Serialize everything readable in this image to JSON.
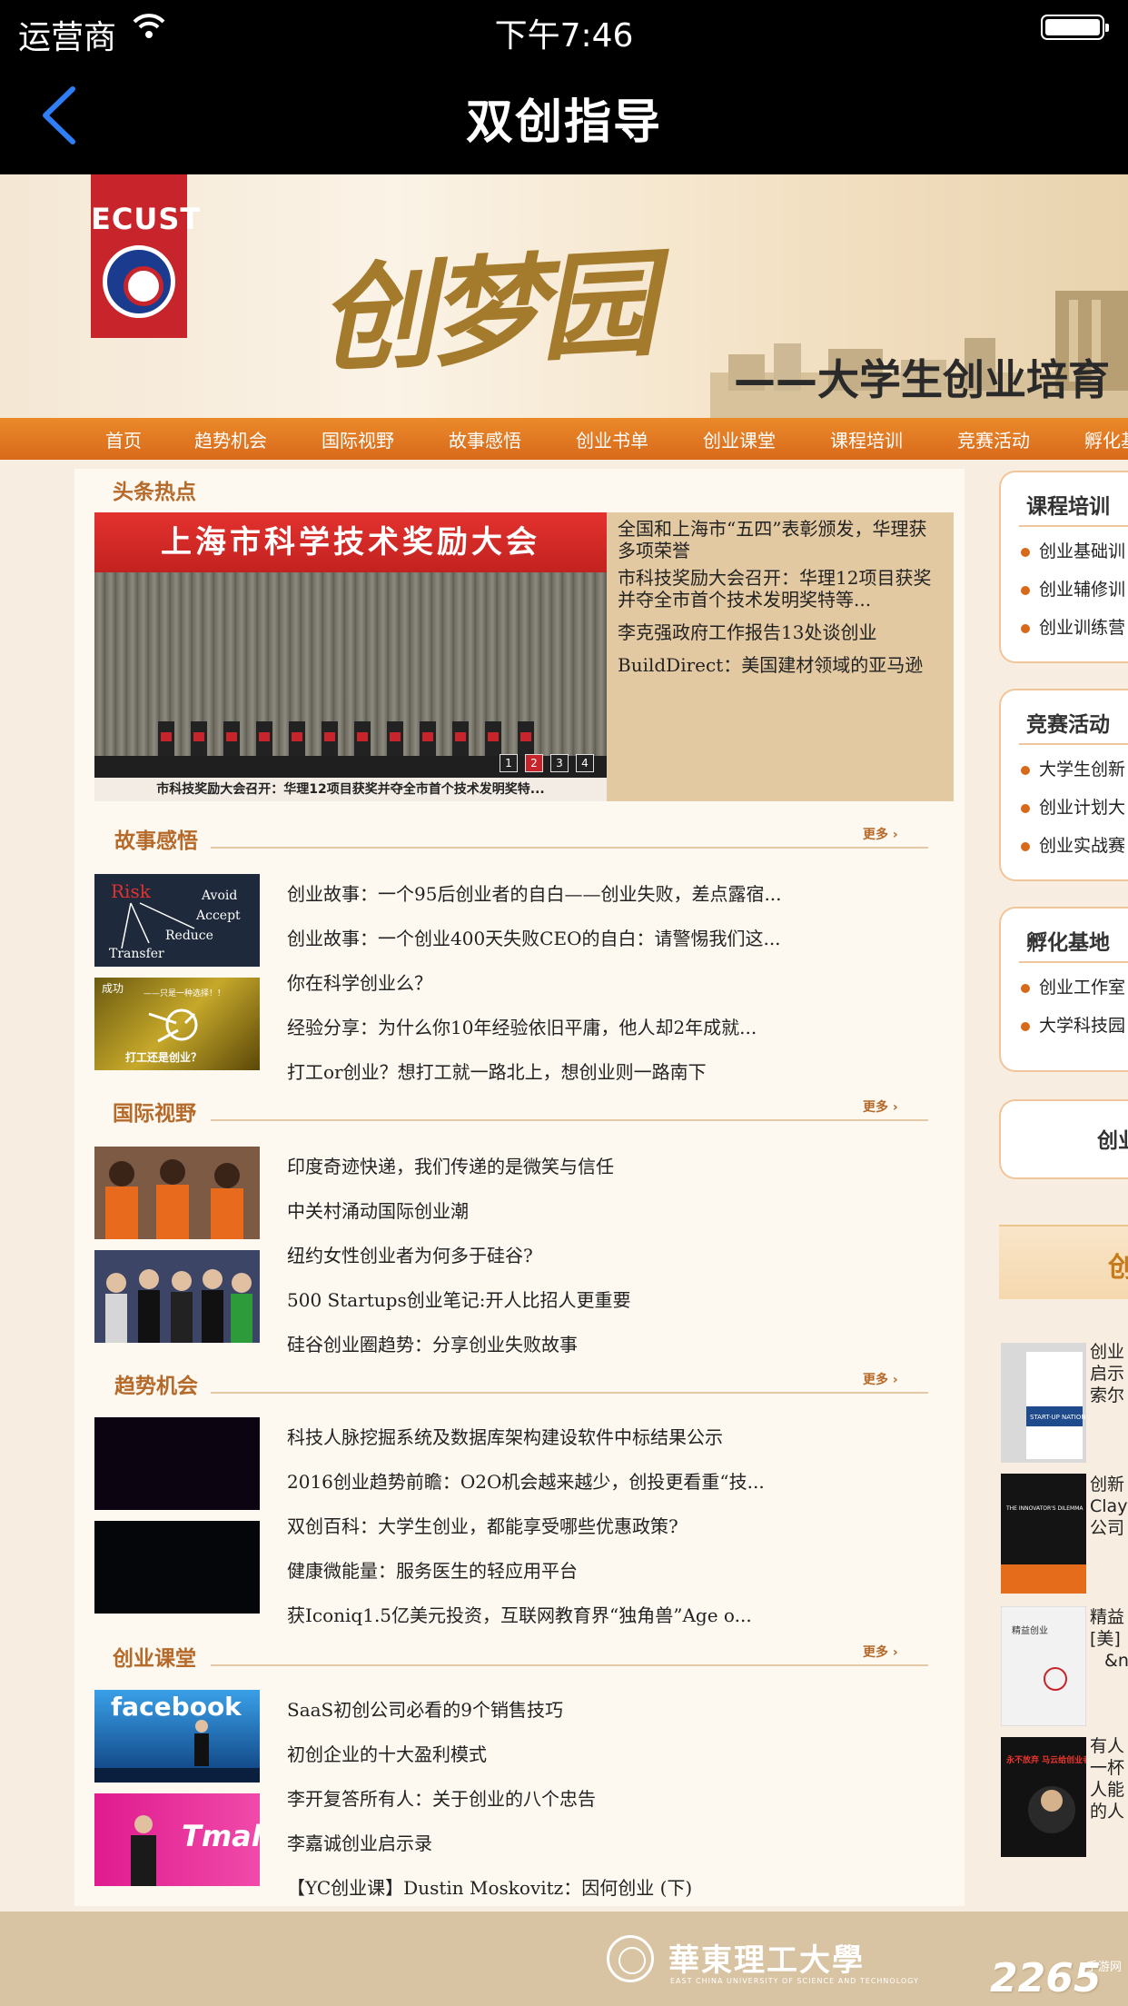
{
  "status": {
    "carrier": "运营商",
    "time": "下午7:46"
  },
  "nav": {
    "title": "双创指导",
    "back_icon": "chevron-left-icon",
    "accent": "#2f7ef5"
  },
  "banner": {
    "school_abbr": "ECUST",
    "brand": "创梦园",
    "subtitle": "——大学生创业培育"
  },
  "menu": [
    "首页",
    "趋势机会",
    "国际视野",
    "故事感悟",
    "创业书单",
    "创业课堂",
    "课程培训",
    "竞赛活动",
    "孵化基"
  ],
  "hot": {
    "title": "头条热点",
    "image_banner": "上海市科学技术奖励大会",
    "caption": "市科技奖励大会召开：华理12项目获奖并夺全市首个技术发明奖特...",
    "pages": [
      "1",
      "2",
      "3",
      "4"
    ],
    "active_page": "2",
    "items": [
      "全国和上海市“五四”表彰颁发，华理获多项荣誉",
      "市科技奖励大会召开：华理12项目获奖并夺全市首个技术发明奖特等...",
      "李克强政府工作报告13处谈创业",
      "BuildDirect：美国建材领域的亚马逊"
    ]
  },
  "sections": {
    "story": {
      "title": "故事感悟",
      "more": "更多",
      "thumb1_text": [
        "Risk",
        "Avoid",
        "Accept",
        "Reduce",
        "Transfer"
      ],
      "thumb2_text": [
        "成功",
        "——只是一种选择！！",
        "打工还是创业？"
      ],
      "links": [
        "创业故事：一个95后创业者的自白——创业失败，差点露宿...",
        "创业故事：一个创业400天失败CEO的自白：请警惕我们这...",
        "你在科学创业么？",
        "经验分享：为什么你10年经验依旧平庸，他人却2年成就...",
        "打工or创业？想打工就一路北上，想创业则一路南下"
      ]
    },
    "intl": {
      "title": "国际视野",
      "more": "更多",
      "links": [
        "印度奇迹快递，我们传递的是微笑与信任",
        "中关村涌动国际创业潮",
        "纽约女性创业者为何多于硅谷?",
        "500 Startups创业笔记:开人比招人更重要",
        "硅谷创业圈趋势：分享创业失败故事"
      ]
    },
    "trend": {
      "title": "趋势机会",
      "more": "更多",
      "links": [
        "科技人脉挖掘系统及数据库架构建设软件中标结果公示",
        "2016创业趋势前瞻：O2O机会越来越少，创投更看重“技...",
        "双创百科：大学生创业，都能享受哪些优惠政策?",
        "健康微能量：服务医生的轻应用平台",
        "获Iconiq1.5亿美元投资，互联网教育界“独角兽”Age o..."
      ]
    },
    "class": {
      "title": "创业课堂",
      "more": "更多",
      "thumb1_text": "facebook",
      "thumb2_text": "Tmall",
      "links": [
        "SaaS初创公司必看的9个销售技巧",
        "初创企业的十大盈利模式",
        "李开复答所有人：关于创业的八个忠告",
        "李嘉诚创业启示录",
        "【YC创业课】Dustin Moskovitz：因何创业 (下)"
      ]
    }
  },
  "sidebar": {
    "course": {
      "title": "课程培训",
      "items": [
        "创业基础训",
        "创业辅修训",
        "创业训练营"
      ]
    },
    "contest": {
      "title": "竞赛活动",
      "items": [
        "大学生创新",
        "创业计划大",
        "创业实战赛"
      ]
    },
    "incubate": {
      "title": "孵化基地",
      "items": [
        "创业工作室",
        "大学科技园"
      ]
    },
    "more_box": "创业",
    "booklist_title": "创",
    "books": [
      {
        "cover": "START-UP NATION",
        "text": [
          "创业",
          "启示",
          "索尔"
        ]
      },
      {
        "cover": "THE INNOVATOR'S DILEMMA",
        "text": [
          "创新",
          "Clayt",
          "公司"
        ]
      },
      {
        "cover": "精益创业",
        "text": [
          "精益",
          "[美]",
          "&n"
        ]
      },
      {
        "cover": "永不放弃 马云给创业者的24堂课",
        "text": [
          "有人",
          "一杯",
          "人能",
          "的人"
        ]
      }
    ]
  },
  "footer": {
    "school_cn": "華東理工大學",
    "school_en": "EAST CHINA UNIVERSITY OF SCIENCE AND TECHNOLOGY",
    "watermark": "2265",
    "watermark_sub": "手游网"
  }
}
